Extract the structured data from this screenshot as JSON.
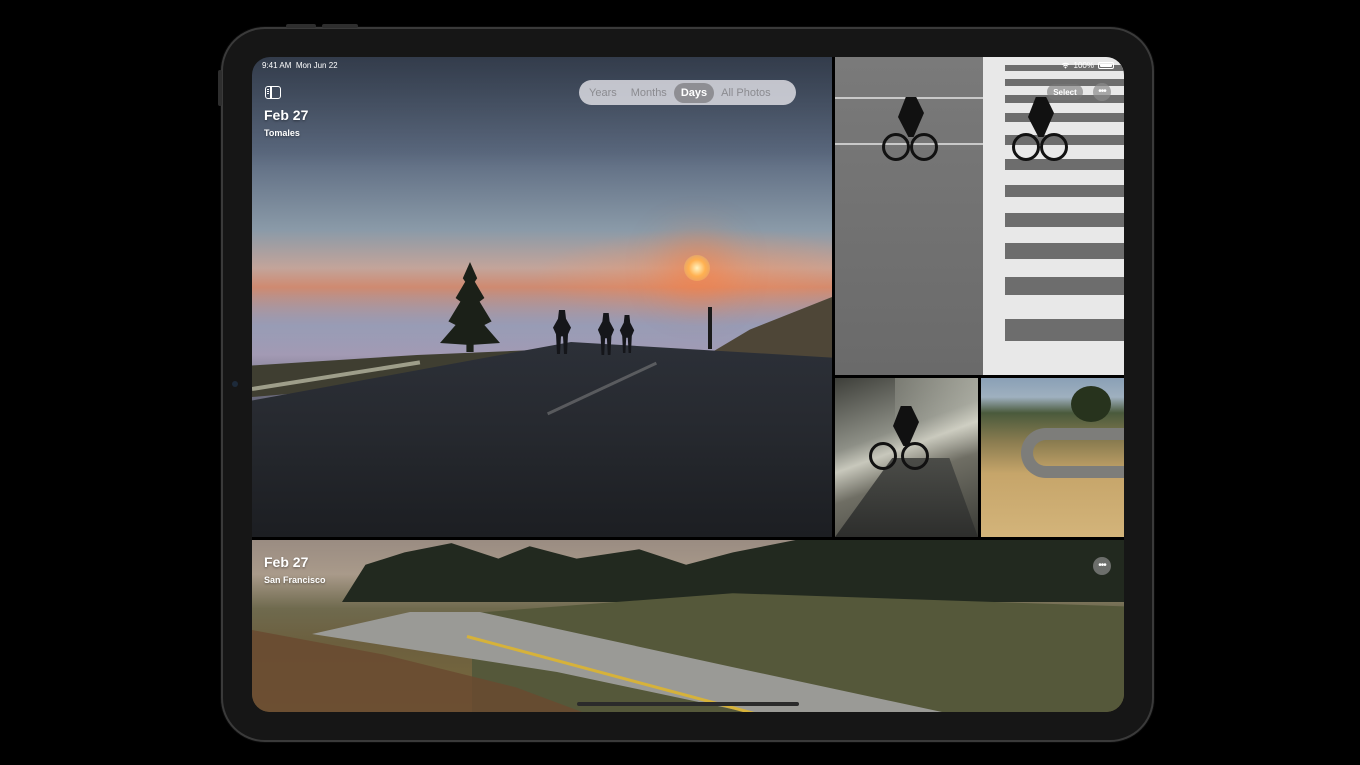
{
  "status_bar": {
    "time": "9:41 AM",
    "date": "Mon Jun 22",
    "battery": "100%"
  },
  "view_switcher": {
    "options": [
      "Years",
      "Months",
      "Days",
      "All Photos"
    ],
    "selected": "Days"
  },
  "toolbar": {
    "select_label": "Select",
    "more_icon": "ellipsis-icon",
    "sidebar_icon": "sidebar-toggle-icon"
  },
  "day_groups": [
    {
      "date": "Feb 27",
      "location": "Tomales"
    },
    {
      "date": "Feb 27",
      "location": "San Francisco"
    }
  ],
  "colors": {
    "segment_selected": "#8e8e93",
    "segment_background": "#e1e1e6",
    "device_frame": "#161616"
  }
}
